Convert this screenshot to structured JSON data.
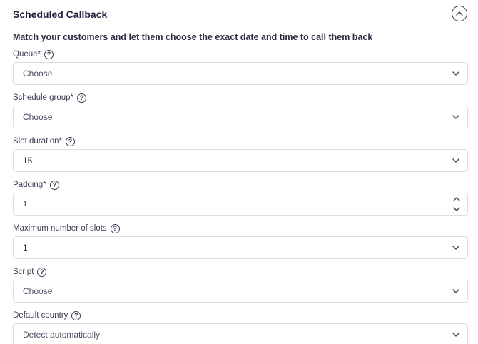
{
  "section": {
    "title": "Scheduled Callback",
    "subtitle": "Match your customers and let them choose the exact date and time to call them back"
  },
  "fields": {
    "queue": {
      "label": "Queue*",
      "value": "Choose"
    },
    "schedule_group": {
      "label": "Schedule group*",
      "value": "Choose"
    },
    "slot_duration": {
      "label": "Slot duration*",
      "value": "15"
    },
    "padding": {
      "label": "Padding*",
      "value": "1"
    },
    "max_slots": {
      "label": "Maximum number of slots",
      "value": "1"
    },
    "script": {
      "label": "Script",
      "value": "Choose"
    },
    "default_country": {
      "label": "Default country",
      "value": "Detect automatically"
    }
  },
  "icons": {
    "collapse": "chevron-up-circle-icon",
    "help": "question-circle-icon",
    "dropdown": "chevron-down-icon",
    "stepper_up": "chevron-up-icon",
    "stepper_down": "chevron-down-icon"
  },
  "help_glyph": "?"
}
